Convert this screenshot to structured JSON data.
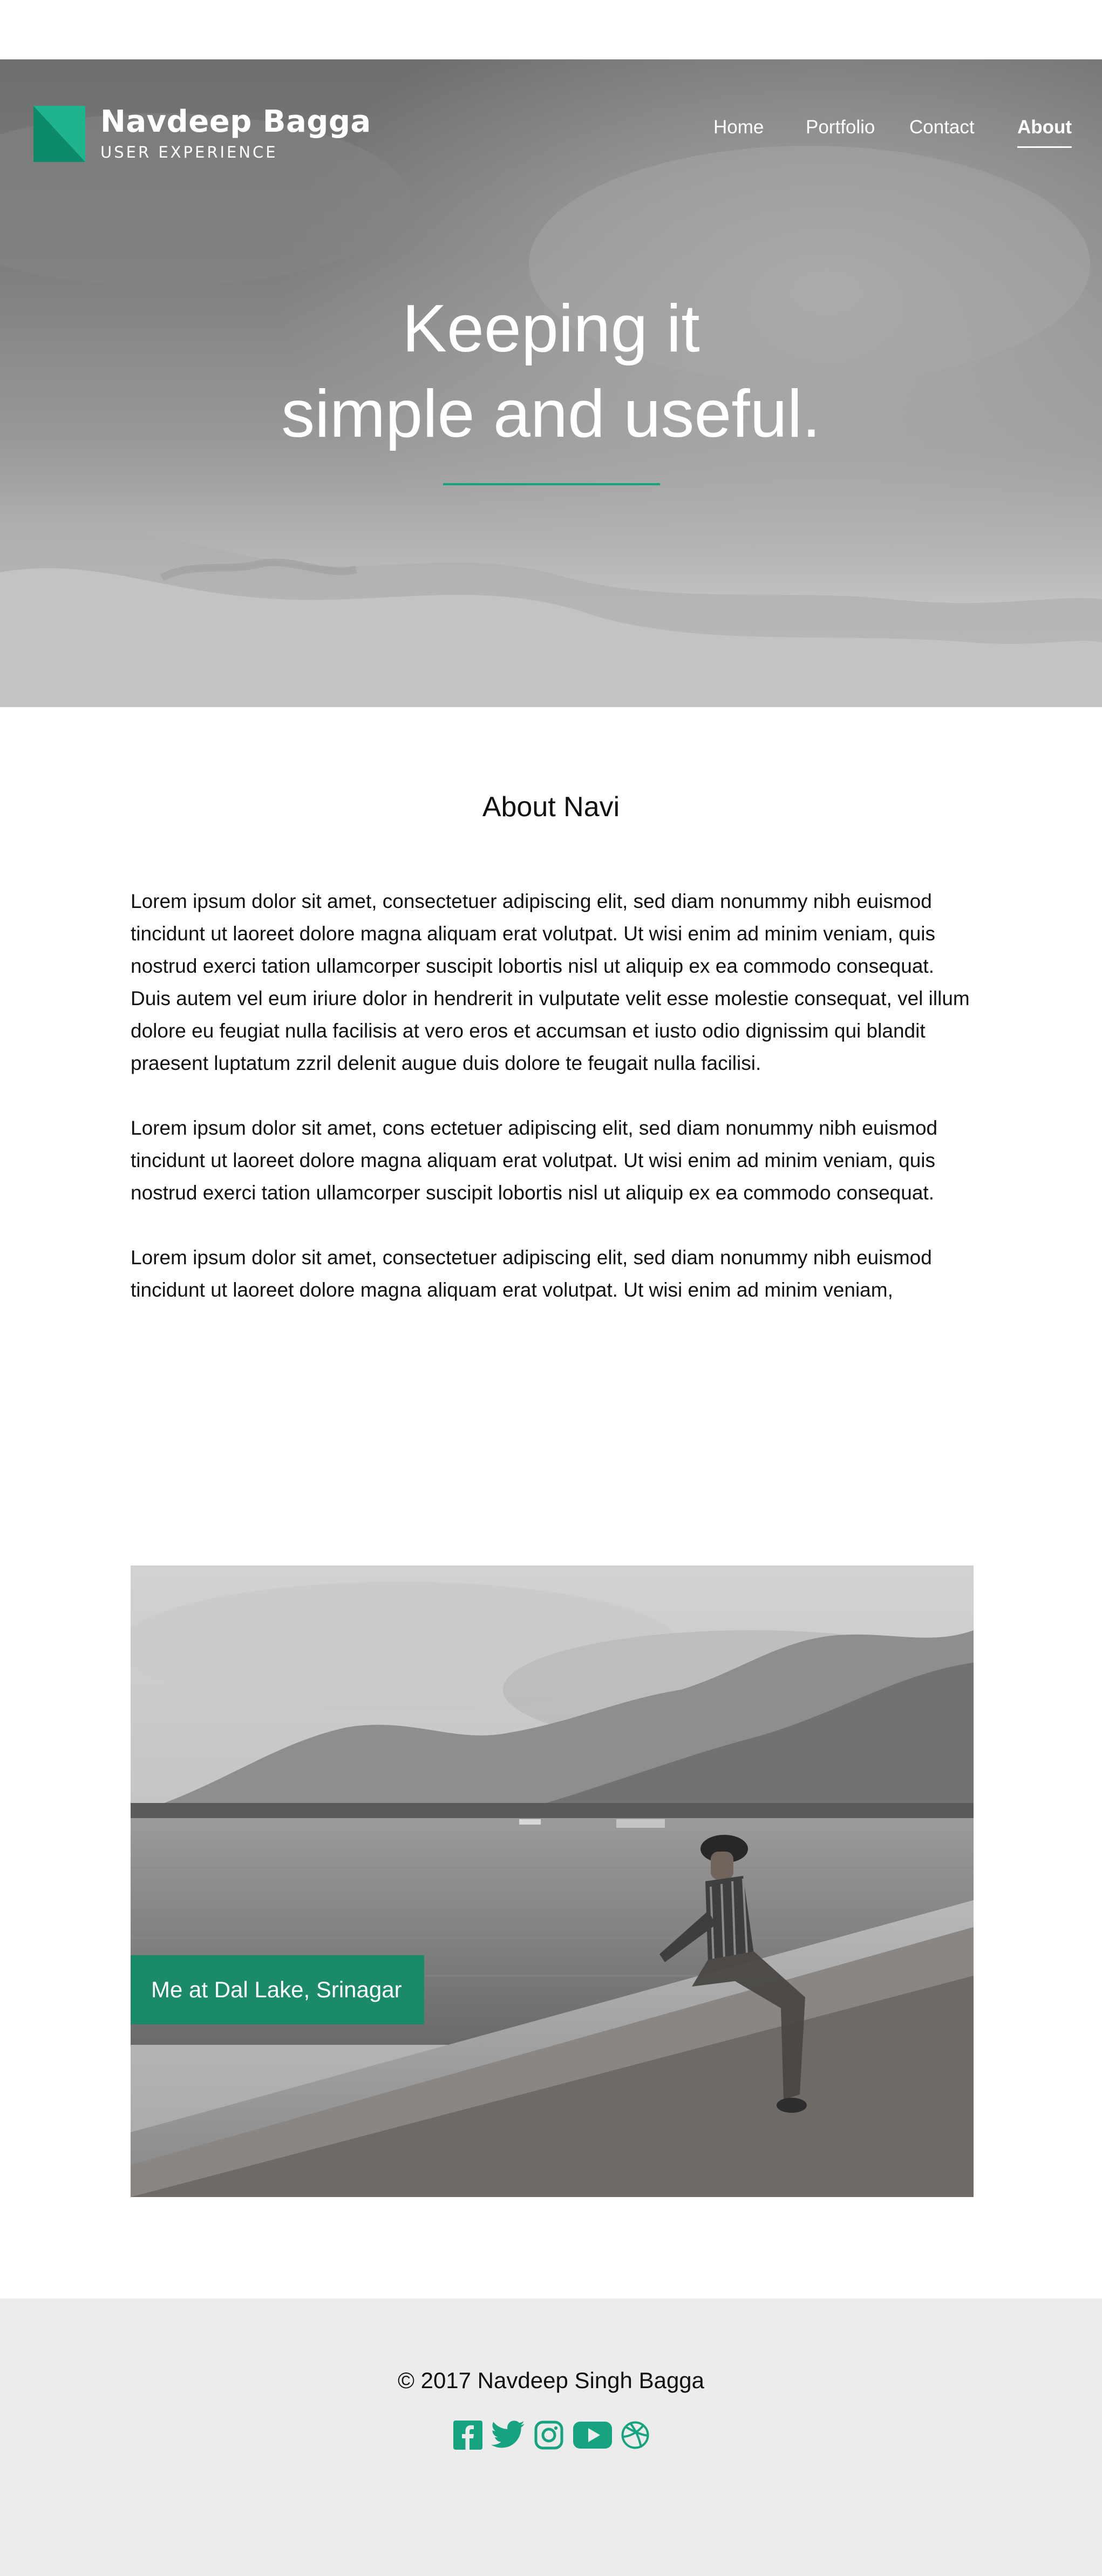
{
  "brand": {
    "name": "Navdeep Bagga",
    "tagline": "USER EXPERIENCE",
    "accent_color": "#16a37f"
  },
  "nav": {
    "items": [
      {
        "label": "Home"
      },
      {
        "label": "Portfolio"
      },
      {
        "label": "Contact"
      },
      {
        "label": "About",
        "active": true
      }
    ]
  },
  "hero": {
    "title_line1": "Keeping it",
    "title_line2": "simple and useful."
  },
  "about": {
    "heading": "About Navi",
    "paragraphs": [
      "Lorem ipsum dolor sit amet, consectetuer adipiscing elit, sed diam nonummy nibh euismod tincidunt ut laoreet dolore magna aliquam erat volutpat. Ut wisi enim ad minim veniam, quis nostrud exerci tation ullamcorper suscipit lobortis nisl ut aliquip ex ea commodo consequat. Duis autem vel eum iriure dolor in hendrerit in vulputate velit esse molestie consequat, vel illum dolore eu feugiat nulla facilisis at vero eros et accumsan et iusto odio dignissim qui blandit praesent luptatum zzril delenit augue duis dolore te feugait nulla facilisi.",
      "Lorem ipsum dolor sit amet, cons ectetuer adipiscing elit, sed diam nonummy nibh euismod tincidunt ut laoreet dolore magna aliquam erat volutpat. Ut wisi enim ad minim veniam, quis nostrud exerci tation ullamcorper suscipit lobortis nisl ut aliquip ex ea commodo consequat.",
      "Lorem ipsum dolor sit amet, consectetuer adipiscing elit, sed diam nonummy nibh euismod tincidunt ut laoreet dolore magna aliquam erat volutpat. Ut wisi enim ad minim veniam,"
    ]
  },
  "photo": {
    "caption": "Me at Dal Lake, Srinagar",
    "caption_bg": "#1b8a6b"
  },
  "footer": {
    "copyright": "© 2017 Navdeep Singh Bagga",
    "social_icons": [
      "facebook-icon",
      "twitter-icon",
      "instagram-icon",
      "youtube-icon",
      "dribbble-icon"
    ],
    "icon_color": "#16a37f",
    "background": "#ececec"
  }
}
